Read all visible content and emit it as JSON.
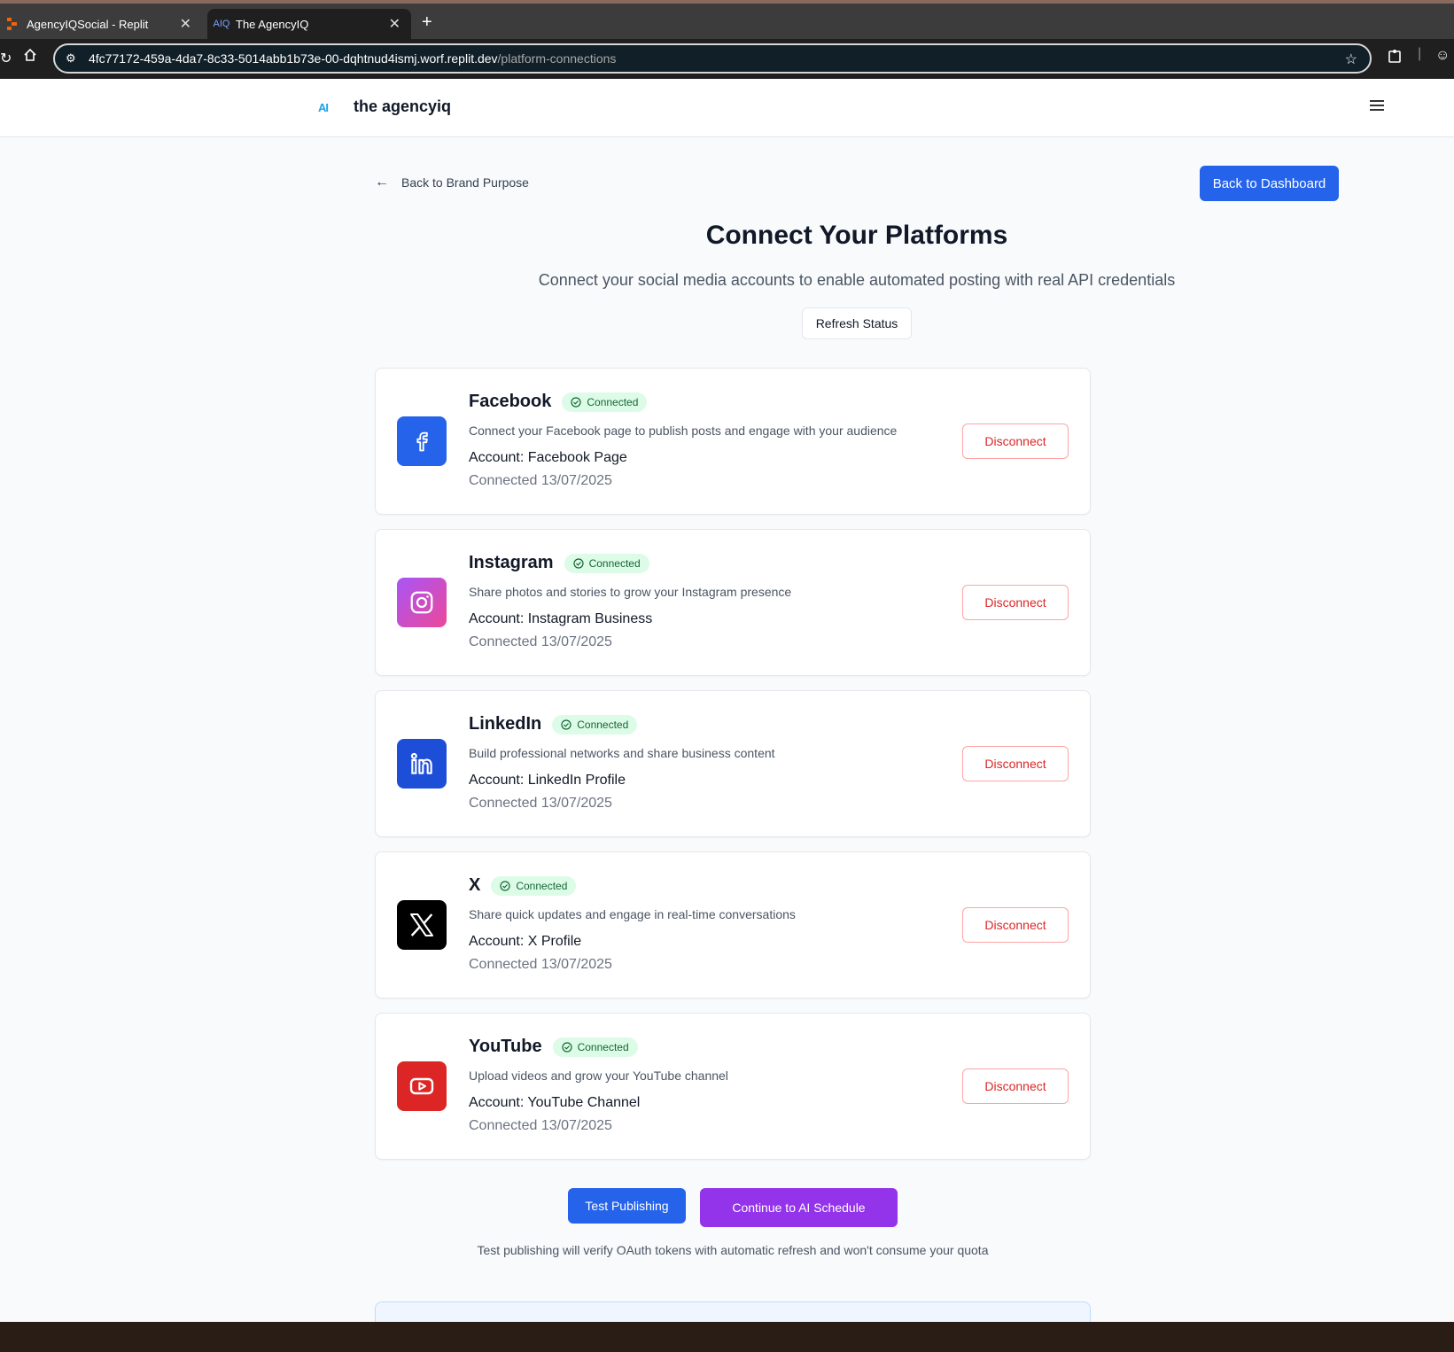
{
  "browser": {
    "tabs": [
      {
        "label": "AgencyIQSocial - Replit",
        "icon": "replit-icon"
      },
      {
        "label": "The AgencyIQ",
        "icon": "agencyiq-icon"
      }
    ],
    "url_host": "4fc77172-459a-4da7-8c33-5014abb1b73e-00-dqhtnud4ismj.worf.replit.dev",
    "url_path": "/platform-connections"
  },
  "header": {
    "logo_mark": "AI",
    "logo_text": "the agencyiq"
  },
  "nav": {
    "back_label": "Back to Brand Purpose",
    "dashboard_label": "Back to Dashboard"
  },
  "main": {
    "title": "Connect Your Platforms",
    "subtitle": "Connect your social media accounts to enable automated posting with real API credentials",
    "refresh_label": "Refresh Status"
  },
  "platforms": [
    {
      "name": "Facebook",
      "status": "Connected",
      "description": "Connect your Facebook page to publish posts and engage with your audience",
      "account": "Account: Facebook Page",
      "connected": "Connected 13/07/2025",
      "action": "Disconnect",
      "color": "#2563eb"
    },
    {
      "name": "Instagram",
      "status": "Connected",
      "description": "Share photos and stories to grow your Instagram presence",
      "account": "Account: Instagram Business",
      "connected": "Connected 13/07/2025",
      "action": "Disconnect",
      "color": "#d946ef"
    },
    {
      "name": "LinkedIn",
      "status": "Connected",
      "description": "Build professional networks and share business content",
      "account": "Account: LinkedIn Profile",
      "connected": "Connected 13/07/2025",
      "action": "Disconnect",
      "color": "#1d4ed8"
    },
    {
      "name": "X",
      "status": "Connected",
      "description": "Share quick updates and engage in real-time conversations",
      "account": "Account: X Profile",
      "connected": "Connected 13/07/2025",
      "action": "Disconnect",
      "color": "#000000"
    },
    {
      "name": "YouTube",
      "status": "Connected",
      "description": "Upload videos and grow your YouTube channel",
      "account": "Account: YouTube Channel",
      "connected": "Connected 13/07/2025",
      "action": "Disconnect",
      "color": "#dc2626"
    }
  ],
  "actions": {
    "test_label": "Test Publishing",
    "continue_label": "Continue to AI Schedule",
    "footnote": "Test publishing will verify OAuth tokens with automatic refresh and won't consume your quota"
  }
}
